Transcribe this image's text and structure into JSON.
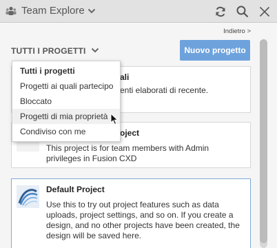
{
  "titlebar": {
    "title": "Team Explore",
    "icons": {
      "team": "team-icon",
      "chevron": "chevron-down-icon",
      "refresh": "refresh-icon",
      "search": "search-icon",
      "close": "close-icon"
    }
  },
  "panel": {
    "back_link": "Indietro >",
    "filter_label": "TUTTI I PROGETTI",
    "new_project_label": "Nuovo progetto",
    "accent_color": "#6ea2dd"
  },
  "cards": [
    {
      "title": "ali",
      "description": "enti elaborati di recente."
    },
    {
      "title": "oject",
      "description": "This project is for team members with Admin privileges in Fusion CXD"
    },
    {
      "title": "Default Project",
      "description": "Use this to try out project features such as data uploads, project settings, and so on. If you create a design, and no other projects have been created, the design will be saved here."
    }
  ],
  "dropdown": {
    "items": [
      {
        "label": "Tutti i progetti"
      },
      {
        "label": "Progetti ai quali partecipo"
      },
      {
        "label": "Bloccato"
      },
      {
        "label": "Progetti di mia proprietà"
      },
      {
        "label": "Condiviso con me"
      }
    ]
  }
}
